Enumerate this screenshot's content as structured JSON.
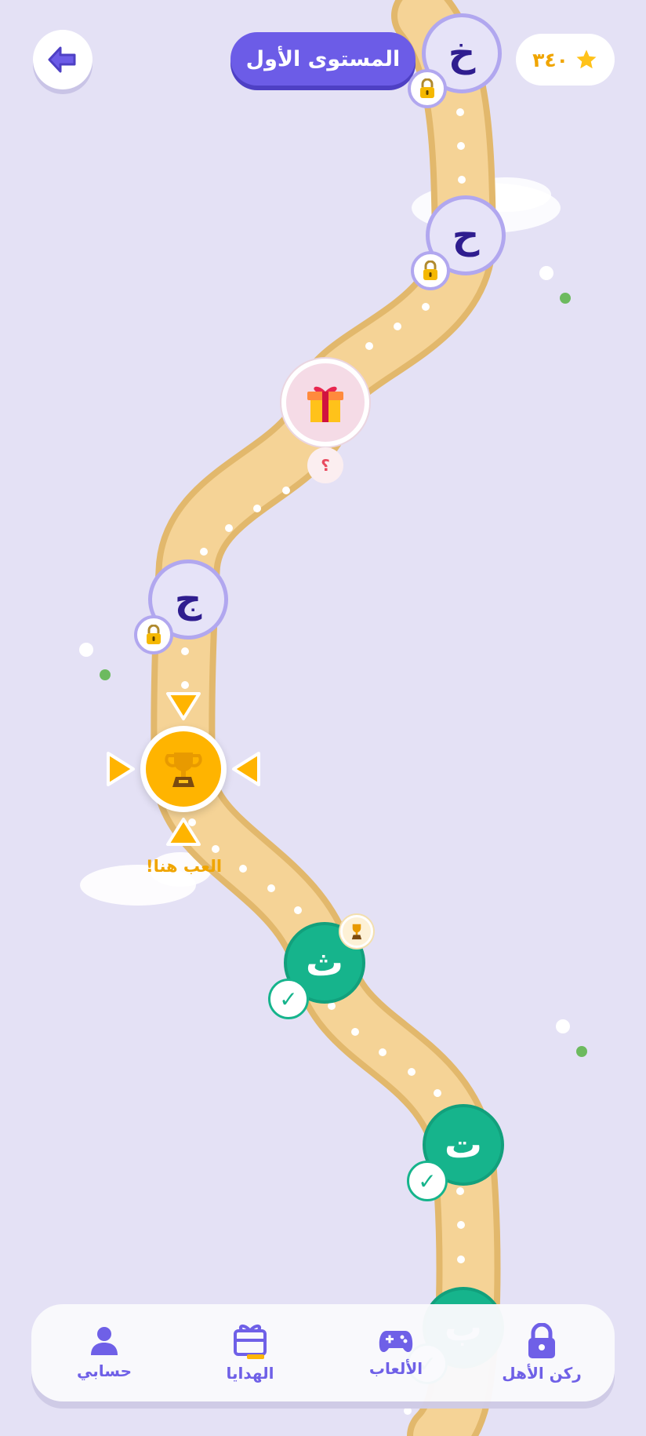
{
  "header": {
    "back_icon": "arrow-left-icon",
    "level_title": "المستوى الأول",
    "score": "٣٤٠",
    "score_icon": "star-icon"
  },
  "map": {
    "nodes": [
      {
        "letter": "خ",
        "state": "locked"
      },
      {
        "letter": "ح",
        "state": "locked"
      },
      {
        "letter": "",
        "state": "gift",
        "badge": "؟"
      },
      {
        "letter": "ج",
        "state": "locked"
      },
      {
        "letter": "",
        "state": "current"
      },
      {
        "letter": "ث",
        "state": "completed"
      },
      {
        "letter": "ت",
        "state": "completed"
      },
      {
        "letter": "ب",
        "state": "completed"
      }
    ],
    "play_here_label": "العب هنا!"
  },
  "bottom_nav": {
    "items": [
      {
        "label": "ركن الأهل",
        "icon": "lock-icon"
      },
      {
        "label": "الألعاب",
        "icon": "gamepad-icon"
      },
      {
        "label": "الهدايا",
        "icon": "gift-icon"
      },
      {
        "label": "حسابي",
        "icon": "person-icon"
      }
    ]
  },
  "colors": {
    "background": "#e4e1f5",
    "primary": "#6c5ce7",
    "path": "#f5d396",
    "path_border": "#e2b86c",
    "completed": "#16b48c",
    "current": "#ffb400",
    "locked_fill": "#e6e3f8",
    "locked_border": "#b1a7ef"
  }
}
